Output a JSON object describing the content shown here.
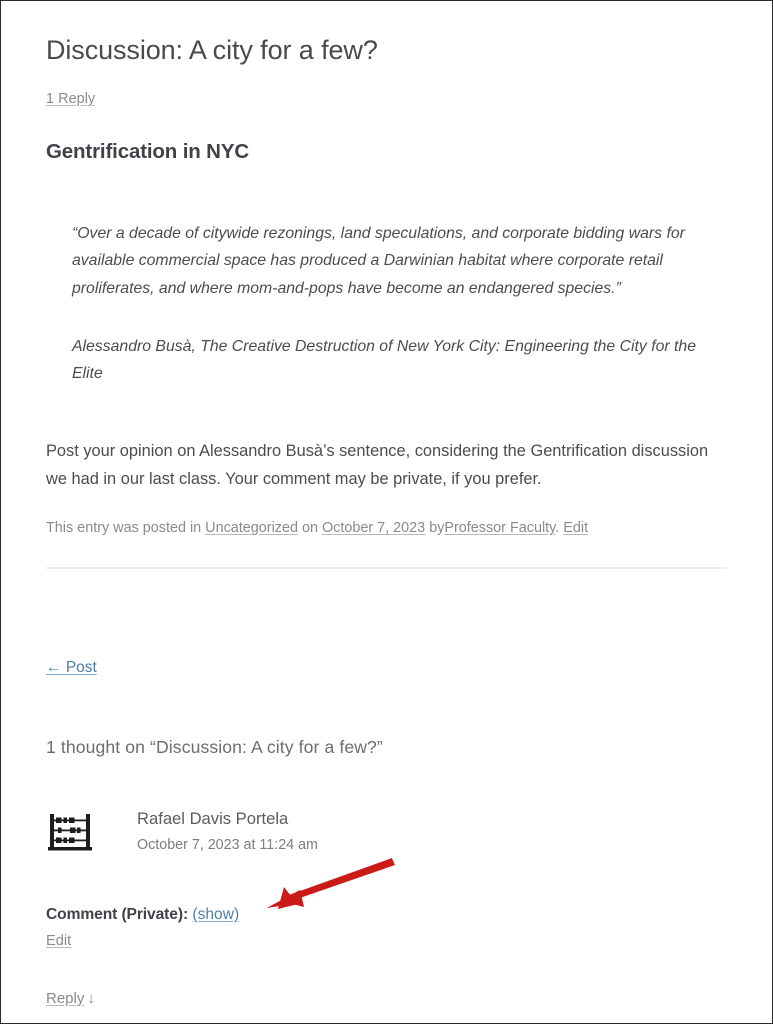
{
  "post": {
    "title": "Discussion: A city for a few?",
    "reply_count_link": "1 Reply",
    "content_heading": "Gentrification in NYC",
    "quote_text": "“Over a decade of citywide rezonings, land speculations, and corporate bidding wars for available commercial space has produced a Darwinian habitat where corporate retail proliferates, and where mom-and-pops have become an endangered species.”",
    "quote_attribution": "Alessandro Busà, The Creative Destruction of New York City: Engineering the City for the Elite",
    "body_text": "Post your opinion on Alessandro Busà’s sentence, considering the Gentrification discussion we had in our last class. Your comment may be private, if you prefer."
  },
  "meta": {
    "posted_in_prefix": "This entry was posted in",
    "category": "Uncategorized",
    "on_label": "on",
    "date": "October 7, 2023",
    "by_label": "by",
    "author": "Professor Faculty",
    "period": ".",
    "edit_label": "Edit"
  },
  "navigation": {
    "prev_arrow": "←",
    "prev_label": "Post"
  },
  "comments": {
    "heading": "1 thought on “Discussion: A city for a few?”",
    "items": [
      {
        "avatar_icon": "abacus-identicon",
        "author": "Rafael Davis Portela",
        "date": "October 7, 2023 at 11:24 am",
        "comment_label": "Comment (Private):",
        "show_link": "(show)",
        "edit_link": "Edit",
        "reply_link": "Reply",
        "reply_arrow": "↓"
      }
    ]
  },
  "annotation": {
    "arrow_icon": "red-arrow-pointing-left",
    "arrow_color": "#cc1a17"
  },
  "colors": {
    "link_blue": "#4d7ea8",
    "link_gray": "#8a8a8a",
    "text_dark": "#3f4348",
    "body_text": "#4c4c4c",
    "border": "#2b2b2b",
    "divider": "#ededed"
  }
}
